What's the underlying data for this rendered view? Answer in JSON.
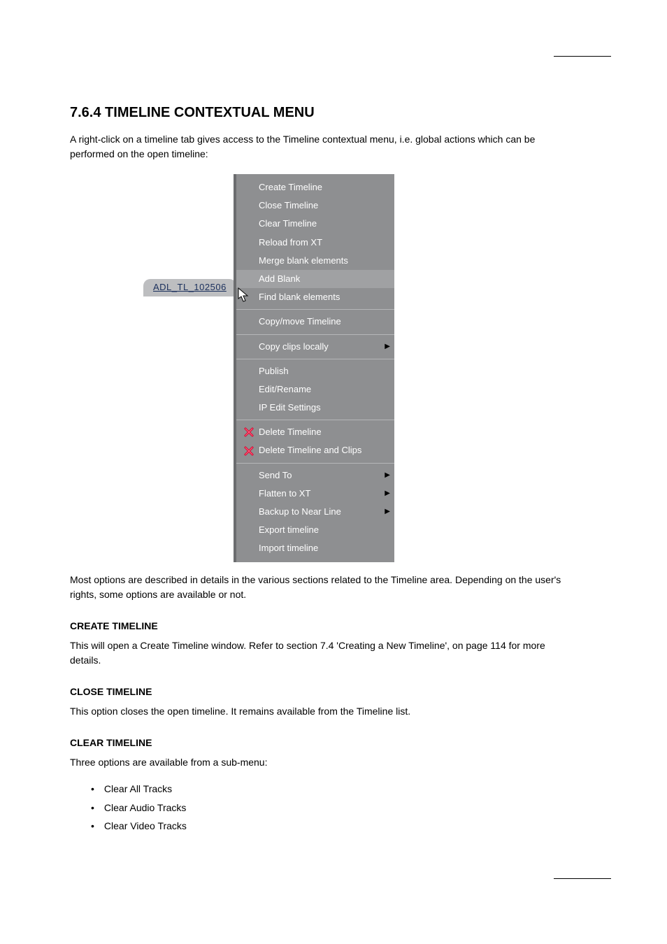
{
  "section": {
    "heading": "7.6.4 TIMELINE CONTEXTUAL MENU",
    "intro": "A right-click on a timeline tab gives access to the Timeline contextual menu, i.e. global actions which can be performed on the open timeline:",
    "tab_label": "ADL_TL_102506",
    "menu": {
      "groups": [
        {
          "items": [
            {
              "label": "Create Timeline",
              "icon": null,
              "submenu": false,
              "highlight": false
            },
            {
              "label": "Close Timeline",
              "icon": null,
              "submenu": false,
              "highlight": false
            },
            {
              "label": "Clear Timeline",
              "icon": null,
              "submenu": false,
              "highlight": false
            },
            {
              "label": "Reload from XT",
              "icon": null,
              "submenu": false,
              "highlight": false
            },
            {
              "label": "Merge blank elements",
              "icon": null,
              "submenu": false,
              "highlight": false
            },
            {
              "label": "Add Blank",
              "icon": null,
              "submenu": false,
              "highlight": true
            },
            {
              "label": "Find blank elements",
              "icon": null,
              "submenu": false,
              "highlight": false
            }
          ]
        },
        {
          "items": [
            {
              "label": "Copy/move Timeline",
              "icon": null,
              "submenu": false,
              "highlight": false
            }
          ]
        },
        {
          "items": [
            {
              "label": "Copy clips locally",
              "icon": null,
              "submenu": true,
              "highlight": false
            }
          ]
        },
        {
          "items": [
            {
              "label": "Publish",
              "icon": null,
              "submenu": false,
              "highlight": false
            },
            {
              "label": "Edit/Rename",
              "icon": null,
              "submenu": false,
              "highlight": false
            },
            {
              "label": "IP Edit Settings",
              "icon": null,
              "submenu": false,
              "highlight": false
            }
          ]
        },
        {
          "items": [
            {
              "label": "Delete Timeline",
              "icon": "x",
              "submenu": false,
              "highlight": false
            },
            {
              "label": "Delete Timeline and Clips",
              "icon": "x",
              "submenu": false,
              "highlight": false
            }
          ]
        },
        {
          "items": [
            {
              "label": "Send To",
              "icon": null,
              "submenu": true,
              "highlight": false
            },
            {
              "label": "Flatten to XT",
              "icon": null,
              "submenu": true,
              "highlight": false
            },
            {
              "label": "Backup to Near Line",
              "icon": null,
              "submenu": true,
              "highlight": false
            },
            {
              "label": "Export timeline",
              "icon": null,
              "submenu": false,
              "highlight": false
            },
            {
              "label": "Import timeline",
              "icon": null,
              "submenu": false,
              "highlight": false
            }
          ]
        }
      ]
    },
    "post_menu_text": "Most options are described in details in the various sections related to the Timeline area. Depending on the user's rights, some options are available or not."
  },
  "create": {
    "heading": "CREATE TIMELINE",
    "text": "This will open a Create Timeline window. Refer to section 7.4 'Creating a New Timeline', on page 114 for more details."
  },
  "close": {
    "heading": "CLOSE TIMELINE",
    "text": "This option closes the open timeline. It remains available from the Timeline list."
  },
  "clear": {
    "heading": "CLEAR TIMELINE",
    "text": "Three options are available from a sub-menu:",
    "bullets": [
      "Clear All Tracks",
      "Clear Audio Tracks",
      "Clear Video Tracks"
    ]
  }
}
